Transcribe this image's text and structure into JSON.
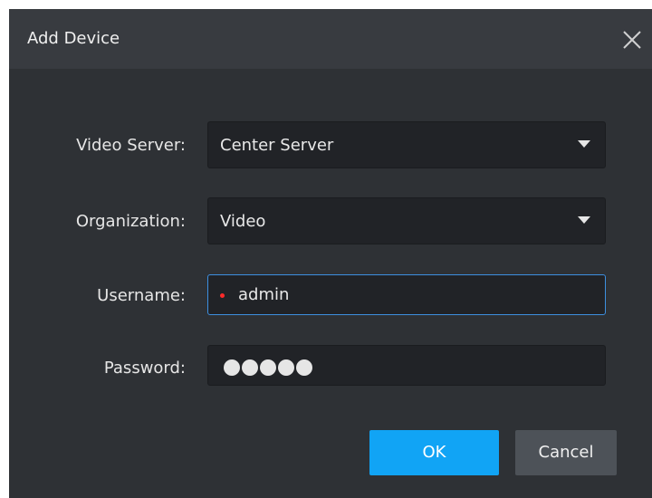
{
  "dialog": {
    "title": "Add Device",
    "close_icon": "close-icon"
  },
  "form": {
    "video_server": {
      "label": "Video Server:",
      "value": "Center Server",
      "icon": "chevron-down-icon"
    },
    "organization": {
      "label": "Organization:",
      "value": "Video",
      "icon": "chevron-down-icon"
    },
    "username": {
      "label": "Username:",
      "value": "admin",
      "required": true
    },
    "password": {
      "label": "Password:",
      "masked_length": 5
    }
  },
  "buttons": {
    "ok": "OK",
    "cancel": "Cancel"
  },
  "colors": {
    "dialog_bg": "#2e3135",
    "titlebar_bg": "#383b40",
    "field_bg": "#212327",
    "focus_border": "#3d8fe0",
    "required": "#ff2a2a",
    "primary": "#11a4f5",
    "secondary": "#4d5258"
  }
}
